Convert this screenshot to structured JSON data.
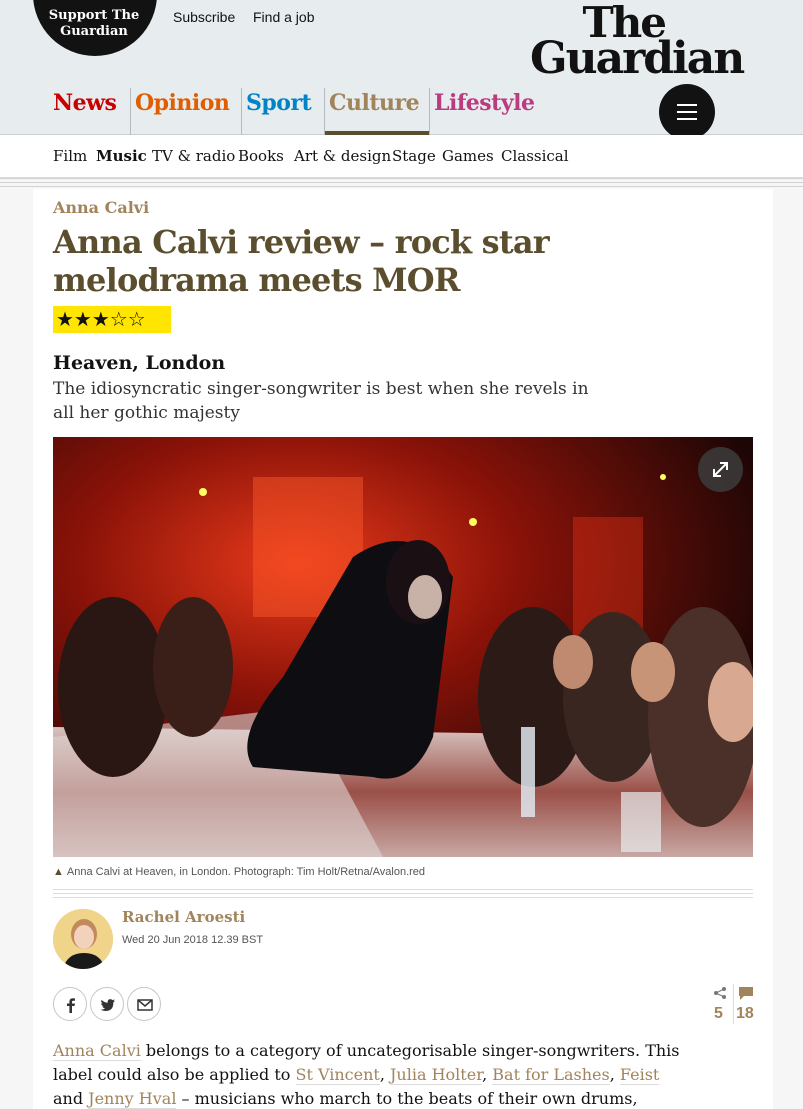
{
  "header": {
    "support_line1": "Support The",
    "support_line2": "Guardian",
    "subscribe": "Subscribe",
    "find_job": "Find a job",
    "logo_line1": "The",
    "logo_line2": "Guardian",
    "pillars": [
      {
        "label": "News",
        "color": "#c70000"
      },
      {
        "label": "Opinion",
        "color": "#e05e00"
      },
      {
        "label": "Sport",
        "color": "#0084c6"
      },
      {
        "label": "Culture",
        "color": "#a1845c"
      },
      {
        "label": "Lifestyle",
        "color": "#bb3b80"
      }
    ],
    "active_pillar": "Culture",
    "menu_icon": "hamburger-icon"
  },
  "subnav": [
    "Film",
    "Music",
    "TV & radio",
    "Books",
    "Art & design",
    "Stage",
    "Games",
    "Classical"
  ],
  "subnav_active": "Music",
  "article": {
    "kicker": "Anna Calvi",
    "headline": "Anna Calvi review – rock star melodrama meets MOR",
    "rating": 3,
    "rating_stars": "★★★☆☆",
    "venue": "Heaven, London",
    "standfirst": "The idiosyncratic singer-songwriter is best when she revels in all her gothic majesty",
    "caption": "Anna Calvi at Heaven, in London. Photograph: Tim Holt/Retna/Avalon.red",
    "author": "Rachel Aroesti",
    "date": "Wed 20 Jun 2018 12.39 BST",
    "share_count": "5",
    "comment_count": "18",
    "body": {
      "p1_link1": "Anna Calvi",
      "p1_text1": " belongs to a category of uncategorisable singer-songwriters. This label could also be applied to ",
      "p1_link2": "St Vincent",
      "p1_sep1": ", ",
      "p1_link3": "Julia Holter",
      "p1_sep2": ", ",
      "p1_link4": "Bat for Lashes",
      "p1_sep3": ", ",
      "p1_link5": "Feist",
      "p1_text2": " and ",
      "p1_link6": "Jenny Hval",
      "p1_text3": " – musicians who march to the beats of their own drums,"
    }
  },
  "colors": {
    "culture_accent": "#a1845c",
    "headline": "#5b4e2e",
    "star_bg": "#ffe500",
    "header_bg": "#e7edef"
  }
}
